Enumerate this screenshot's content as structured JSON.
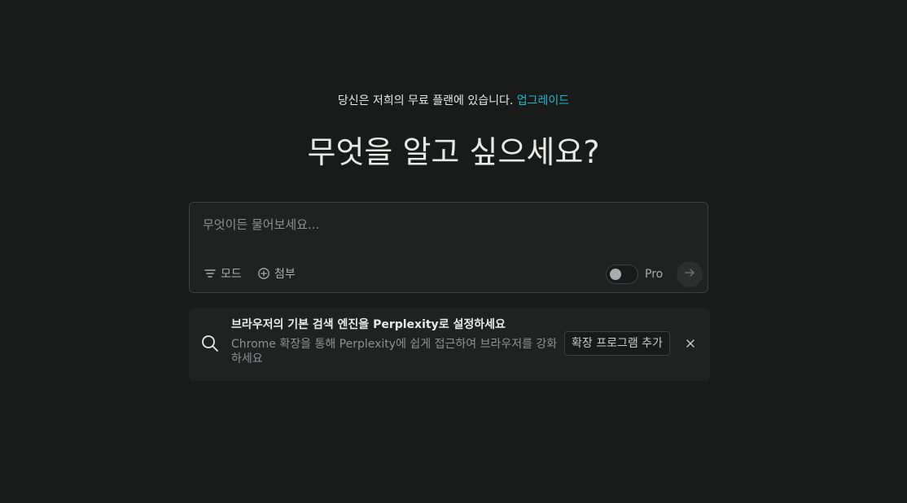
{
  "plan_notice": {
    "text": "당신은 저희의 무료 플랜에 있습니다.",
    "upgrade_link": "업그레이드"
  },
  "hero": {
    "title": "무엇을 알고 싶으세요?"
  },
  "ask_box": {
    "placeholder": "무엇이든 물어보세요...",
    "value": "",
    "mode_label": "모드",
    "attach_label": "첨부",
    "pro_label": "Pro",
    "pro_enabled": false
  },
  "promo": {
    "title_prefix": "브라우저의 기본 검색 엔진을 ",
    "title_brand": "Perplexity",
    "title_suffix": "로 설정하세요",
    "description": "Chrome 확장을 통해 Perplexity에 쉽게 접근하여 브라우저를 강화하세요",
    "install_label": "확장 프로그램 추가"
  },
  "icons": {
    "mode": "filter-icon",
    "attach": "plus-circle-icon",
    "submit": "arrow-right-icon",
    "promo": "search-icon",
    "close": "close-icon"
  },
  "colors": {
    "background": "#191a1a",
    "card": "#202222",
    "accent": "#20b8cd",
    "text": "#e8e8e6",
    "muted": "#8d9191"
  }
}
